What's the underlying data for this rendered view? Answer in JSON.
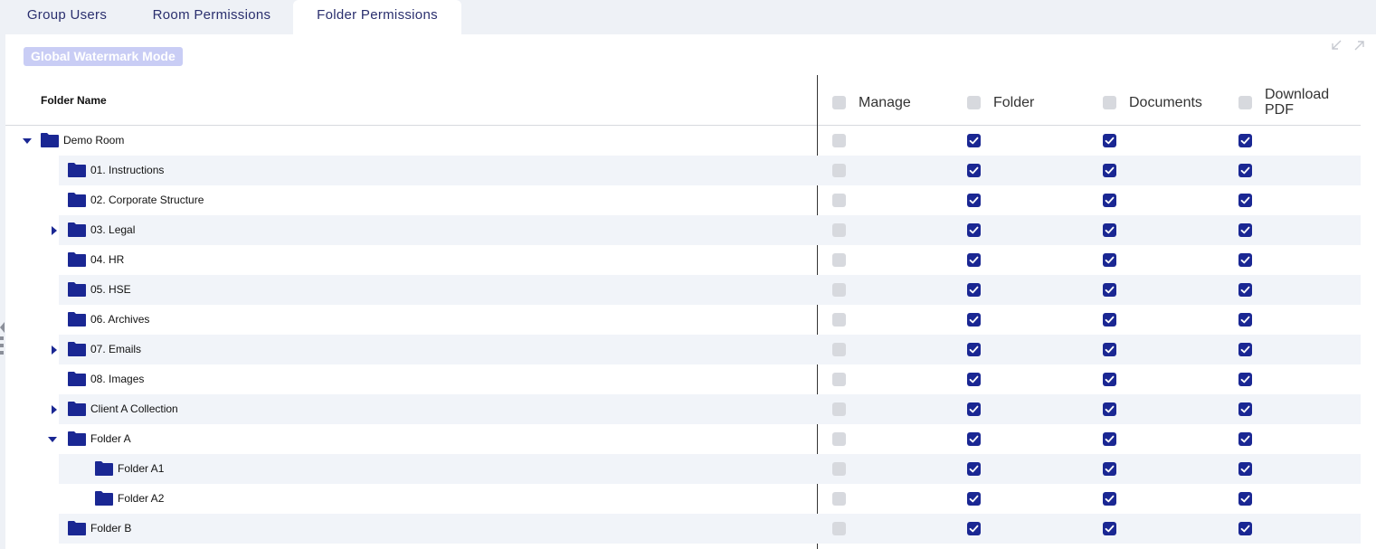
{
  "tabs": [
    {
      "label": "Group Users",
      "active": false
    },
    {
      "label": "Room Permissions",
      "active": false
    },
    {
      "label": "Folder Permissions",
      "active": true
    }
  ],
  "watermark_button": "Global Watermark Mode",
  "columns": {
    "folder_name": "Folder Name",
    "manage": "Manage",
    "folder": "Folder",
    "documents": "Documents",
    "download_pdf_line1": "Download",
    "download_pdf_line2": "PDF"
  },
  "rows": [
    {
      "name": "Demo Room",
      "level": 0,
      "caret": "down",
      "manage": false,
      "folder": true,
      "documents": true,
      "download_pdf": true
    },
    {
      "name": "01. Instructions",
      "level": 1,
      "caret": "none",
      "manage": false,
      "folder": true,
      "documents": true,
      "download_pdf": true
    },
    {
      "name": "02. Corporate Structure",
      "level": 1,
      "caret": "none",
      "manage": false,
      "folder": true,
      "documents": true,
      "download_pdf": true
    },
    {
      "name": "03. Legal",
      "level": 1,
      "caret": "right",
      "manage": false,
      "folder": true,
      "documents": true,
      "download_pdf": true
    },
    {
      "name": "04. HR",
      "level": 1,
      "caret": "none",
      "manage": false,
      "folder": true,
      "documents": true,
      "download_pdf": true
    },
    {
      "name": "05. HSE",
      "level": 1,
      "caret": "none",
      "manage": false,
      "folder": true,
      "documents": true,
      "download_pdf": true
    },
    {
      "name": "06. Archives",
      "level": 1,
      "caret": "none",
      "manage": false,
      "folder": true,
      "documents": true,
      "download_pdf": true
    },
    {
      "name": "07. Emails",
      "level": 1,
      "caret": "right",
      "manage": false,
      "folder": true,
      "documents": true,
      "download_pdf": true
    },
    {
      "name": "08. Images",
      "level": 1,
      "caret": "none",
      "manage": false,
      "folder": true,
      "documents": true,
      "download_pdf": true
    },
    {
      "name": "Client A Collection",
      "level": 1,
      "caret": "right",
      "manage": false,
      "folder": true,
      "documents": true,
      "download_pdf": true
    },
    {
      "name": "Folder A",
      "level": 1,
      "caret": "down",
      "manage": false,
      "folder": true,
      "documents": true,
      "download_pdf": true
    },
    {
      "name": "Folder A1",
      "level": 2,
      "caret": "none",
      "manage": false,
      "folder": true,
      "documents": true,
      "download_pdf": true
    },
    {
      "name": "Folder A2",
      "level": 2,
      "caret": "none",
      "manage": false,
      "folder": true,
      "documents": true,
      "download_pdf": true
    },
    {
      "name": "Folder B",
      "level": 1,
      "caret": "none",
      "manage": false,
      "folder": true,
      "documents": true,
      "download_pdf": true
    }
  ],
  "icons": {
    "folder": "folder-icon",
    "expand": "caret-right-icon",
    "collapse": "caret-down-icon",
    "checked": "checkmark-icon",
    "collapse_panel": "arrow-in-icon",
    "expand_panel": "arrow-out-icon"
  },
  "colors": {
    "accent": "#1a2793",
    "tab_text": "#2a2f6e",
    "unchecked": "#d7d9de",
    "stripe": "#f1f4f9",
    "badge": "#c9cdf5"
  }
}
